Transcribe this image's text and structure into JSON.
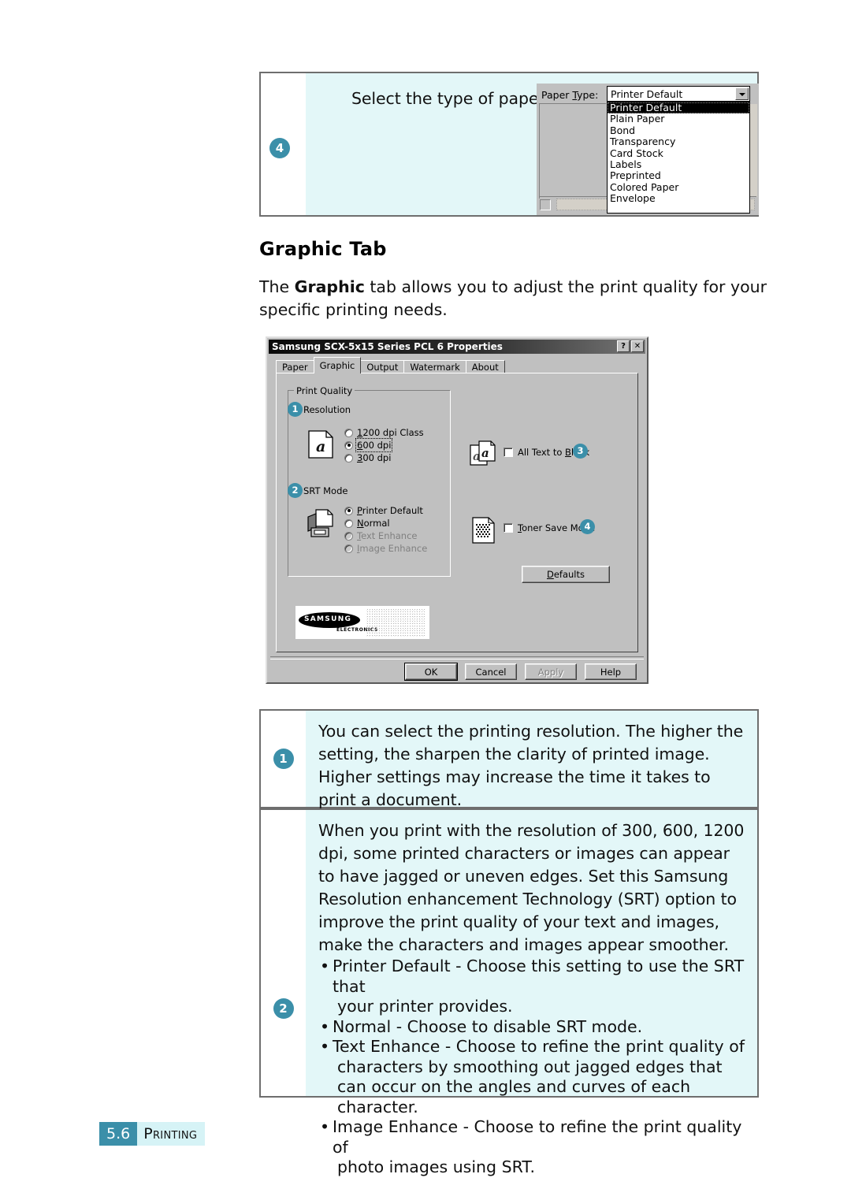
{
  "colors": {
    "accent_teal": "#3b8fa9",
    "callout_bg": "#e3f7f8",
    "footer_section_bg": "#d6f3f6",
    "dialog_face": "#c0c0c0"
  },
  "top_callout": {
    "badge": "4",
    "text": "Select the type of paper you are using.",
    "paper_type": {
      "label": "Paper Type:",
      "label_prefix": "Paper ",
      "label_accesskey": "T",
      "label_suffix": "ype:",
      "selected_value": "Printer Default",
      "dropdown_icon": "chevron-down-icon",
      "options": [
        "Printer Default",
        "Plain Paper",
        "Bond",
        "Transparency",
        "Card Stock",
        "Labels",
        "Preprinted",
        "Colored Paper",
        "Envelope"
      ]
    }
  },
  "heading": "Graphic Tab",
  "intro": {
    "before": "The ",
    "bold": "Graphic",
    "after": " tab allows you to adjust the print quality for your specific printing needs."
  },
  "dialog": {
    "title": "Samsung SCX-5x15 Series PCL 6 Properties",
    "titlebar_buttons": [
      {
        "name": "help-button",
        "glyph": "?"
      },
      {
        "name": "close-button",
        "glyph": "✕"
      }
    ],
    "tabs": [
      {
        "label": "Paper",
        "active": false
      },
      {
        "label": "Graphic",
        "active": true
      },
      {
        "label": "Output",
        "active": false
      },
      {
        "label": "Watermark",
        "active": false
      },
      {
        "label": "About",
        "active": false
      }
    ],
    "groupbox_title": "Print Quality",
    "resolution": {
      "badge": "1",
      "label": "Resolution",
      "icon": "page-with-a-icon",
      "options": [
        {
          "label_accesskey": "1",
          "label_rest": "200 dpi Class",
          "selected": false,
          "disabled": false,
          "focused": false
        },
        {
          "label_accesskey": "6",
          "label_rest": "00 dpi",
          "selected": true,
          "disabled": false,
          "focused": true
        },
        {
          "label_accesskey": "3",
          "label_rest": "00 dpi",
          "selected": false,
          "disabled": false,
          "focused": false
        }
      ]
    },
    "srt_mode": {
      "badge": "2",
      "label": "SRT Mode",
      "icon": "printer-page-icon",
      "options": [
        {
          "label_accesskey": "P",
          "label_rest": "rinter Default",
          "selected": true,
          "disabled": false
        },
        {
          "label_accesskey": "N",
          "label_rest": "ormal",
          "selected": false,
          "disabled": false
        },
        {
          "label_accesskey": "T",
          "label_rest": "ext Enhance",
          "selected": false,
          "disabled": true
        },
        {
          "label_accesskey": "I",
          "label_rest": "mage Enhance",
          "selected": false,
          "disabled": true
        }
      ]
    },
    "all_text_to_black": {
      "badge": "3",
      "label_pre": "All Text to ",
      "label_accesskey": "B",
      "label_post": "lack",
      "checked": false,
      "icon": "overlapping-a-pages-icon"
    },
    "toner_save_mode": {
      "badge": "4",
      "label_accesskey": "T",
      "label_post": "oner Save Mode",
      "checked": false,
      "icon": "halftone-page-icon"
    },
    "defaults_button": {
      "accesskey": "D",
      "rest": "efaults"
    },
    "logo": {
      "word": "SAMSUNG",
      "sub": "ELECTRONICS"
    },
    "action_buttons": [
      {
        "label": "OK",
        "default": true,
        "disabled": false
      },
      {
        "label": "Cancel",
        "default": false,
        "disabled": false
      },
      {
        "label": "Apply",
        "default": false,
        "disabled": true
      },
      {
        "label": "Help",
        "default": false,
        "disabled": false
      }
    ]
  },
  "note1": {
    "badge": "1",
    "text": "You can select the printing resolution. The higher the setting, the sharpen the clarity of printed image. Higher settings may increase the time it takes to print a document."
  },
  "note2": {
    "badge": "2",
    "paragraph": "When you print with the resolution of 300, 600, 1200 dpi, some printed characters or images can appear to have jagged or uneven edges. Set this Samsung Resolution enhancement Technology (SRT) option to improve the print quality of your text and images, make the characters and images appear smoother.",
    "bullets": [
      {
        "line1": "Printer Default - Choose this setting to use the SRT that",
        "line2": "your printer provides."
      },
      {
        "line1": "Normal - Choose to disable SRT mode.",
        "line2": ""
      },
      {
        "line1": "Text Enhance - Choose to refine the print quality of",
        "line2": "characters by smoothing out jagged edges that can occur on the angles and curves of each character."
      },
      {
        "line1": "Image Enhance - Choose to refine the print quality of",
        "line2": "photo images using SRT."
      }
    ]
  },
  "footer": {
    "page_number": "5.6",
    "section": "Printing"
  }
}
